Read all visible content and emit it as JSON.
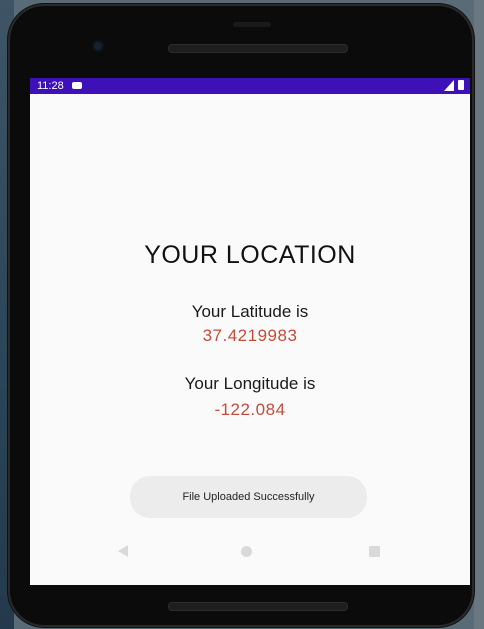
{
  "status_bar": {
    "time": "11:28",
    "notification_icon": "notification-icon",
    "signal_icon": "signal-icon",
    "battery_icon": "battery-icon",
    "color": "#3d10b8"
  },
  "main": {
    "title": "YOUR LOCATION",
    "latitude_label": "Your Latitude is",
    "latitude_value": "37.4219983",
    "longitude_label": "Your Longitude is",
    "longitude_value": "-122.084",
    "value_color": "#c34d3a"
  },
  "toast": {
    "message": "File Uploaded Successfully"
  },
  "nav_bar": {
    "back_icon": "back-icon",
    "home_icon": "home-icon",
    "recents_icon": "recents-icon"
  }
}
